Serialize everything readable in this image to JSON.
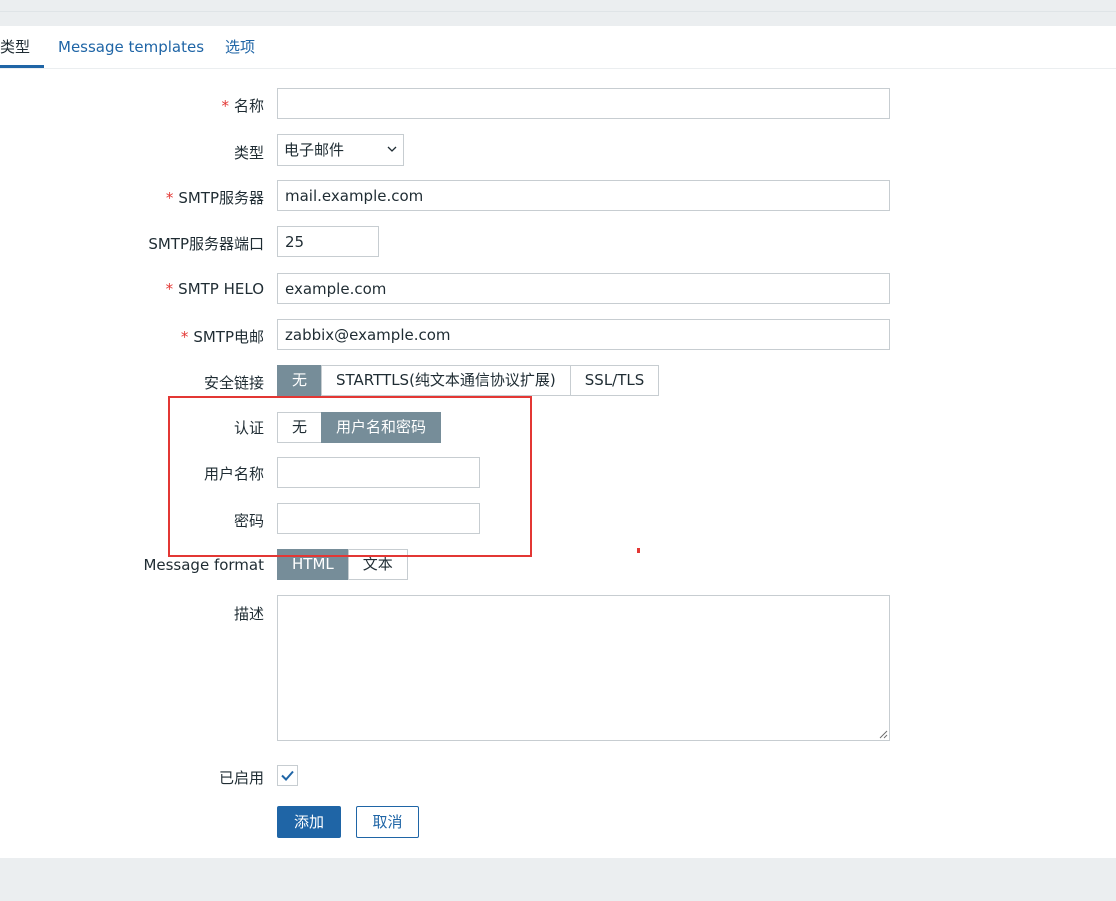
{
  "tabs": [
    {
      "label": "类型",
      "active": true
    },
    {
      "label": "Message templates",
      "active": false
    },
    {
      "label": "选项",
      "active": false
    }
  ],
  "form": {
    "name": {
      "label": "名称",
      "required": true,
      "value": ""
    },
    "type": {
      "label": "类型",
      "value": "电子邮件"
    },
    "smtp_server": {
      "label": "SMTP服务器",
      "required": true,
      "value": "mail.example.com"
    },
    "smtp_port": {
      "label": "SMTP服务器端口",
      "value": "25"
    },
    "smtp_helo": {
      "label": "SMTP HELO",
      "required": true,
      "value": "example.com"
    },
    "smtp_email": {
      "label": "SMTP电邮",
      "required": true,
      "value": "zabbix@example.com"
    },
    "security": {
      "label": "安全链接",
      "options": [
        "无",
        "STARTTLS(纯文本通信协议扩展)",
        "SSL/TLS"
      ],
      "selected": "无"
    },
    "auth": {
      "label": "认证",
      "options": [
        "无",
        "用户名和密码"
      ],
      "selected": "用户名和密码"
    },
    "username": {
      "label": "用户名称",
      "value": ""
    },
    "password": {
      "label": "密码",
      "value": ""
    },
    "message_format": {
      "label": "Message format",
      "options": [
        "HTML",
        "文本"
      ],
      "selected": "HTML"
    },
    "description": {
      "label": "描述",
      "value": ""
    },
    "enabled": {
      "label": "已启用",
      "checked": true
    }
  },
  "buttons": {
    "add": "添加",
    "cancel": "取消"
  },
  "required_marker": "*",
  "colors": {
    "accent": "#1f65a6",
    "segment_selected": "#768d99",
    "required": "#e33734",
    "highlight_box": "#e33734",
    "page_bg": "#ebeef0"
  },
  "icons": {
    "type_dropdown": "chevron-down-icon",
    "enabled_check": "checkmark-icon",
    "resize": "resize-grip-icon"
  }
}
